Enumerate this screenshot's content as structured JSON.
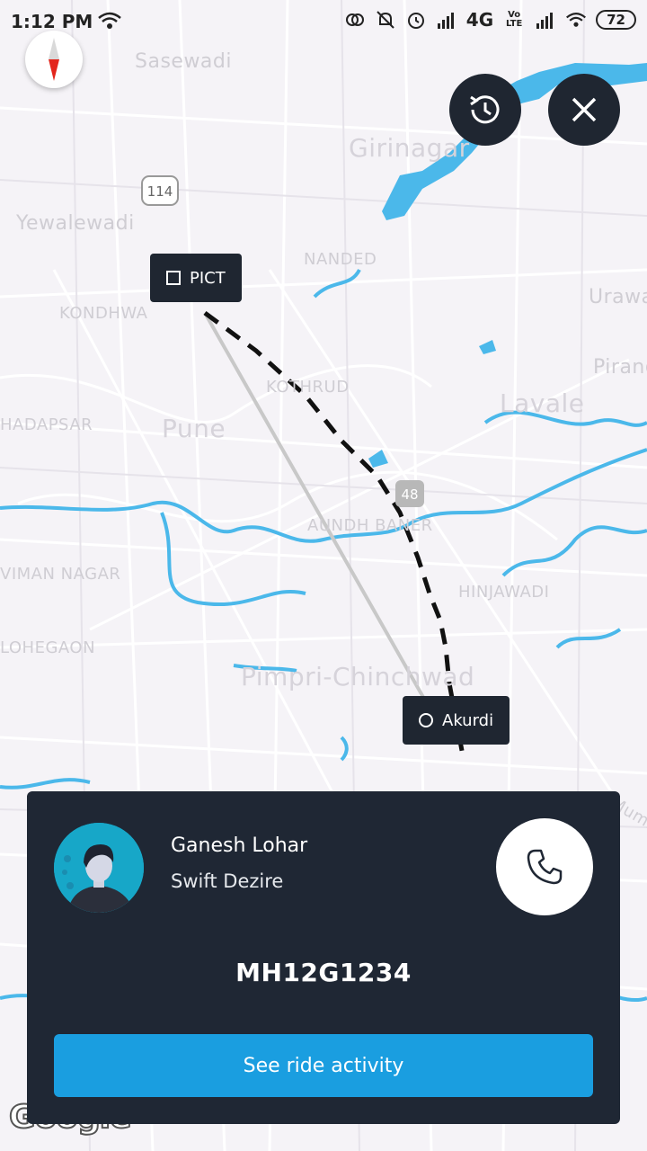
{
  "status_bar": {
    "time": "1:12 PM",
    "network": "4G",
    "carrier_badge": "Vo LTE",
    "battery": "72"
  },
  "map": {
    "labels": [
      "Sasewadi",
      "Girinagar",
      "Yewalewadi",
      "NANDED",
      "KONDHWA",
      "KOTHRUD",
      "Pune",
      "HADAPSAR",
      "Lavale",
      "Urawade",
      "Pirangut",
      "AUNDH BANER",
      "HINJAWADI",
      "VIMAN NAGAR",
      "LOHEGAON",
      "Pimpri-Chinchwad",
      "Mumbai"
    ],
    "shields": [
      "114",
      "48"
    ],
    "river_color": "#4bb8ea"
  },
  "pins": {
    "pickup": "PICT",
    "dropoff": "Akurdi"
  },
  "icons": {
    "compass": "compass-icon",
    "history": "history-icon",
    "close": "close-icon",
    "call": "phone-icon"
  },
  "ride_card": {
    "driver_name": "Ganesh Lohar",
    "car_model": "Swift Dezire",
    "plate": "MH12G1234",
    "activity_button": "See ride activity"
  },
  "map_attribution": "Google"
}
